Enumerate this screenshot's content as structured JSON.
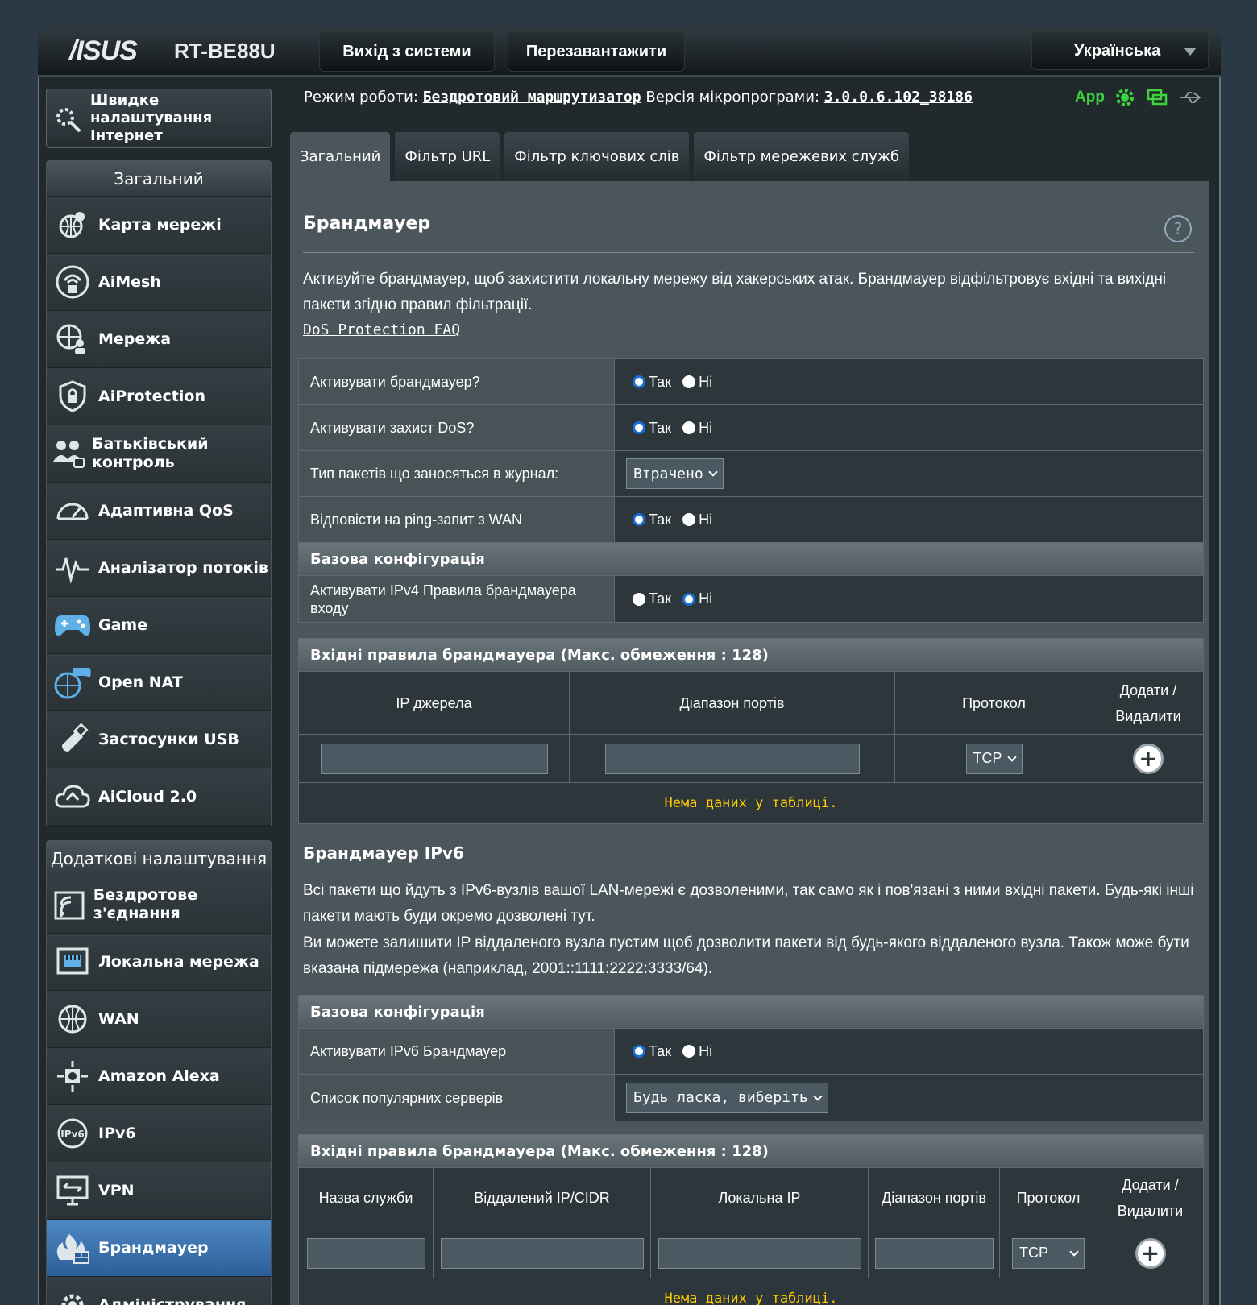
{
  "header": {
    "logo": "/ISUS",
    "model": "RT-BE88U",
    "logout_label": "Вихід з системи",
    "reboot_label": "Перезавантажити",
    "language": "Українська"
  },
  "status": {
    "mode_label": "Режим роботи:",
    "mode_value": "Бездротовий маршрутизатор",
    "firmware_label": "Версія мікропрограми:",
    "firmware_value": "3.0.0.6.102_38186",
    "app_label": "App"
  },
  "sidebar": {
    "quick_setup": "Швидке налаштування Інтернет",
    "general_title": "Загальний",
    "general_items": [
      {
        "label": "Карта мережі"
      },
      {
        "label": "AiMesh"
      },
      {
        "label": "Мережа"
      },
      {
        "label": "AiProtection"
      },
      {
        "label": "Батьківський контроль"
      },
      {
        "label": "Адаптивна QoS"
      },
      {
        "label": "Аналізатор потоків"
      },
      {
        "label": "Game"
      },
      {
        "label": "Open NAT"
      },
      {
        "label": "Застосунки USB"
      },
      {
        "label": "AiCloud 2.0"
      }
    ],
    "advanced_title": "Додаткові налаштування",
    "advanced_items": [
      {
        "label": "Бездротове з'єднання"
      },
      {
        "label": "Локальна мережа"
      },
      {
        "label": "WAN"
      },
      {
        "label": "Amazon Alexa"
      },
      {
        "label": "IPv6"
      },
      {
        "label": "VPN"
      },
      {
        "label": "Брандмауер"
      },
      {
        "label": "Адміністрування"
      }
    ]
  },
  "tabs": [
    {
      "label": "Загальний"
    },
    {
      "label": "Фільтр URL"
    },
    {
      "label": "Фільтр ключових слів"
    },
    {
      "label": "Фільтр мережевих служб"
    }
  ],
  "panel": {
    "title": "Брандмауер",
    "help": "?",
    "description": "Активуйте брандмауер, щоб захистити локальну мережу від хакерських атак. Брандмауер відфільтровує вхідні та вихідні пакети згідно правил фільтрації.",
    "dos_link": "DoS Protection FAQ",
    "yes": "Так",
    "no": "Ні",
    "rows": {
      "enable_firewall": "Активувати брандмауер?",
      "enable_dos": "Активувати захист DoS?",
      "log_type": "Тип пакетів що заносяться в журнал:",
      "log_type_value": "Втрачено",
      "ping_wan": "Відповісти на ping-запит з WAN"
    },
    "basic_config": "Базова конфігурація",
    "ipv4_inbound": "Активувати IPv4 Правила брандмауера входу",
    "inbound_rules_title": "Вхідні правила брандмауера (Макс. обмеження : 128)",
    "ipv4_table": {
      "headers": [
        "IP джерела",
        "Діапазон портів",
        "Протокол",
        "Додати / Видалити"
      ],
      "protocol": "TCP",
      "empty": "Нема даних у таблиці."
    },
    "ipv6_title": "Брандмауер IPv6",
    "ipv6_desc1": "Всі пакети що йдуть з IPv6-вузлів вашої LAN-мережі є дозволеними, так само як і пов'язані з ними вхідні пакети. Будь-які інші пакети мають буди окремо дозволені тут.",
    "ipv6_desc2": "Ви можете залишити IP віддаленого вузла пустим щоб дозволити пакети від будь-якого віддаленого вузла. Також може бути вказана підмережа (наприклад, 2001::1111:2222:3333/64).",
    "ipv6_enable": "Активувати IPv6 Брандмауер",
    "popular_servers": "Список популярних серверів",
    "popular_servers_value": "Будь ласка, виберіть",
    "ipv6_table": {
      "headers": [
        "Назва служби",
        "Віддалений IP/CIDR",
        "Локальна IP",
        "Діапазон портів",
        "Протокол",
        "Додати / Видалити"
      ],
      "protocol": "TCP",
      "empty": "Нема даних у таблиці."
    }
  },
  "colors": {
    "active_menu": "#3a72b0",
    "nodata": "#ffcc00",
    "status_green": "#3fd23f"
  }
}
